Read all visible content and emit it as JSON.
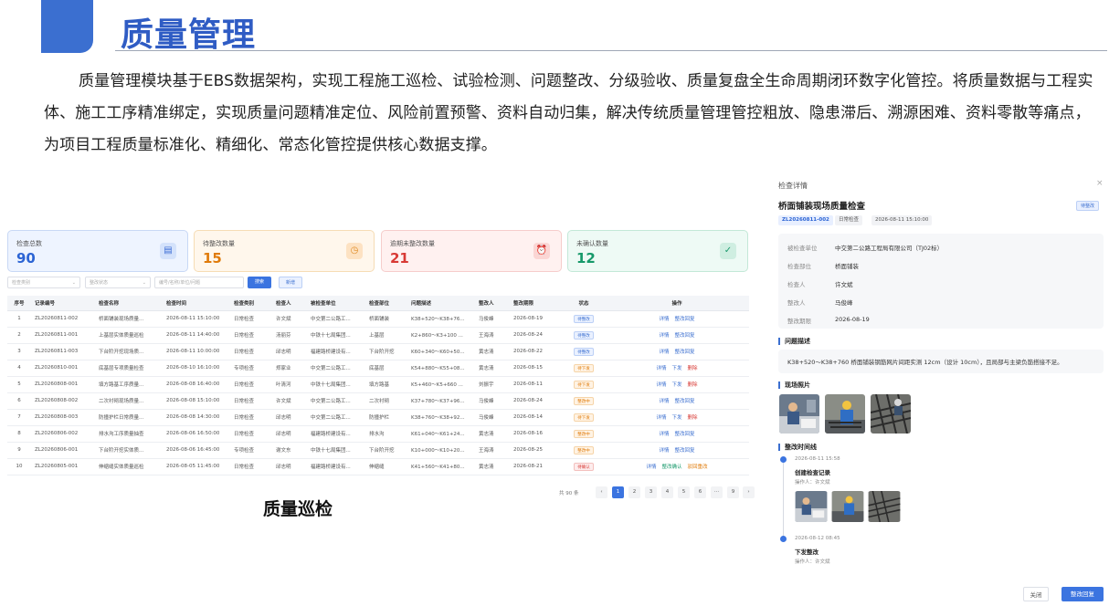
{
  "header": {
    "title": "质量管理",
    "intro": "质量管理模块基于EBS数据架构，实现工程施工巡检、试验检测、问题整改、分级验收、质量复盘全生命周期闭环数字化管控。将质量数据与工程实体、施工工序精准绑定，实现质量问题精准定位、风险前置预警、资料自动归集，解决传统质量管理管控粗放、隐患滞后、溯源困难、资料零散等痛点，为项目工程质量标准化、精细化、常态化管控提供核心数据支撑。"
  },
  "stats": [
    {
      "label": "检查总数",
      "value": "90",
      "icon": "document-icon"
    },
    {
      "label": "待整改数量",
      "value": "15",
      "icon": "clock-icon"
    },
    {
      "label": "逾期未整改数量",
      "value": "21",
      "icon": "alarm-icon"
    },
    {
      "label": "未确认数量",
      "value": "12",
      "icon": "check-circle-icon"
    }
  ],
  "filters": {
    "type_placeholder": "检查类别",
    "status_placeholder": "整改状态",
    "search_placeholder": "编号/名称/单位/问题",
    "search_btn": "搜索",
    "add_btn": "新增"
  },
  "table": {
    "headers": [
      "序号",
      "记录编号",
      "检查名称",
      "检查时间",
      "检查类别",
      "检查人",
      "被检查单位",
      "检查部位",
      "问题描述",
      "整改人",
      "整改期限",
      "状态",
      "操作"
    ],
    "rows": [
      {
        "no": "1",
        "code": "ZL20260811-002",
        "name": "桥面铺装现场质量...",
        "time": "2026-08-11 15:10:00",
        "cat": "日常检查",
        "checker": "许文斌",
        "unit": "中交第二公路工...",
        "part": "桥面铺装",
        "desc": "K38+520～K38+76...",
        "fixer": "马俊峰",
        "due": "2026-08-19",
        "status": "待整改",
        "tag": "blue",
        "ops": [
          [
            "详情",
            "blue"
          ],
          [
            "整改回复",
            "blue"
          ]
        ]
      },
      {
        "no": "2",
        "code": "ZL20260811-001",
        "name": "上基层实体质量巡检",
        "time": "2026-08-11 14:40:00",
        "cat": "日常检查",
        "checker": "汤丽芬",
        "unit": "中铁十七局集团...",
        "part": "上基层",
        "desc": "K2+860～K3+100 ...",
        "fixer": "王海涛",
        "due": "2026-08-24",
        "status": "待整改",
        "tag": "blue",
        "ops": [
          [
            "详情",
            "blue"
          ],
          [
            "整改回复",
            "blue"
          ]
        ]
      },
      {
        "no": "3",
        "code": "ZL20260811-003",
        "name": "下台阶开挖现场质...",
        "time": "2026-08-11 10:00:00",
        "cat": "日常检查",
        "checker": "邱志明",
        "unit": "福建路桥建设有...",
        "part": "下台阶开挖",
        "desc": "K60+340～K60+50...",
        "fixer": "黄志清",
        "due": "2026-08-22",
        "status": "待整改",
        "tag": "blue",
        "ops": [
          [
            "详情",
            "blue"
          ],
          [
            "整改回复",
            "blue"
          ]
        ]
      },
      {
        "no": "4",
        "code": "ZL20260810-001",
        "name": "底基层专项质量检查",
        "time": "2026-08-10 16:10:00",
        "cat": "专项检查",
        "checker": "郑家业",
        "unit": "中交第二公路工...",
        "part": "底基层",
        "desc": "K54+880～K55+08...",
        "fixer": "黄志清",
        "due": "2026-08-15",
        "status": "待下发",
        "tag": "orange",
        "ops": [
          [
            "详情",
            "blue"
          ],
          [
            "下发",
            "blue"
          ],
          [
            "删除",
            "red"
          ]
        ]
      },
      {
        "no": "5",
        "code": "ZL20260808-001",
        "name": "填方路基工序质量...",
        "time": "2026-08-08 16:40:00",
        "cat": "日常检查",
        "checker": "叶清河",
        "unit": "中铁十七局集团...",
        "part": "填方路基",
        "desc": "K5+460～K5+660 ...",
        "fixer": "刘振宇",
        "due": "2026-08-11",
        "status": "待下发",
        "tag": "orange",
        "ops": [
          [
            "详情",
            "blue"
          ],
          [
            "下发",
            "blue"
          ],
          [
            "删除",
            "red"
          ]
        ]
      },
      {
        "no": "6",
        "code": "ZL20260808-002",
        "name": "二次衬砌现场质量...",
        "time": "2026-08-08 15:10:00",
        "cat": "日常检查",
        "checker": "许文斌",
        "unit": "中交第二公路工...",
        "part": "二次衬砌",
        "desc": "K37+780～K37+96...",
        "fixer": "马俊峰",
        "due": "2026-08-24",
        "status": "整改中",
        "tag": "orange",
        "ops": [
          [
            "详情",
            "blue"
          ],
          [
            "整改回复",
            "blue"
          ]
        ]
      },
      {
        "no": "7",
        "code": "ZL20260808-003",
        "name": "防撞护栏日常质量...",
        "time": "2026-08-08 14:30:00",
        "cat": "日常检查",
        "checker": "邱志明",
        "unit": "中交第二公路工...",
        "part": "防撞护栏",
        "desc": "K38+760～K38+92...",
        "fixer": "马俊峰",
        "due": "2026-08-14",
        "status": "待下发",
        "tag": "orange",
        "ops": [
          [
            "详情",
            "blue"
          ],
          [
            "下发",
            "blue"
          ],
          [
            "删除",
            "red"
          ]
        ]
      },
      {
        "no": "8",
        "code": "ZL20260806-002",
        "name": "排水沟工序质量抽查",
        "time": "2026-08-06 16:50:00",
        "cat": "日常检查",
        "checker": "邱志明",
        "unit": "福建路桥建设有...",
        "part": "排水沟",
        "desc": "K61+040～K61+24...",
        "fixer": "黄志清",
        "due": "2026-08-16",
        "status": "整改中",
        "tag": "orange",
        "ops": [
          [
            "详情",
            "blue"
          ],
          [
            "整改回复",
            "blue"
          ]
        ]
      },
      {
        "no": "9",
        "code": "ZL20260806-001",
        "name": "下台阶开挖实体质...",
        "time": "2026-08-06 16:45:00",
        "cat": "专项检查",
        "checker": "谢文东",
        "unit": "中铁十七局集团...",
        "part": "下台阶开挖",
        "desc": "K10+000～K10+20...",
        "fixer": "王海涛",
        "due": "2026-08-25",
        "status": "整改中",
        "tag": "orange",
        "ops": [
          [
            "详情",
            "blue"
          ],
          [
            "整改回复",
            "blue"
          ]
        ]
      },
      {
        "no": "10",
        "code": "ZL20260805-001",
        "name": "伸缩缝实体质量巡检",
        "time": "2026-08-05 11:45:00",
        "cat": "日常检查",
        "checker": "邱志明",
        "unit": "福建路桥建设有...",
        "part": "伸缩缝",
        "desc": "K41+560～K41+80...",
        "fixer": "黄志清",
        "due": "2026-08-21",
        "status": "待确认",
        "tag": "red",
        "ops": [
          [
            "详情",
            "blue"
          ],
          [
            "整改确认",
            "green"
          ],
          [
            "驳回重改",
            "orange"
          ]
        ]
      }
    ]
  },
  "pager": {
    "total": "共 90 条",
    "prev": "‹",
    "pages": [
      "1",
      "2",
      "3",
      "4",
      "5",
      "6",
      "···",
      "9"
    ],
    "next": "›"
  },
  "caption_left": "质量巡检",
  "detail": {
    "head": "检查详情",
    "close": "×",
    "title": "桥面铺装现场质量检查",
    "status": "待整改",
    "chips": [
      "ZL20260811-002",
      "日常检查",
      "2026-08-11 15:10:00"
    ],
    "info": [
      {
        "k": "被检查单位",
        "v": "中交第二公路工程局有限公司（TJ02标）"
      },
      {
        "k": "检查部位",
        "v": "桥面铺装"
      },
      {
        "k": "检查人",
        "v": "许文斌"
      },
      {
        "k": "整改人",
        "v": "马俊峰"
      },
      {
        "k": "整改期限",
        "v": "2026-08-19"
      }
    ],
    "sec_desc": "问题描述",
    "desc": "K38+520～K38+760 桥面铺装钢筋网片间距实测 12cm（设计 10cm），且局部与主梁负筋搭接不足。",
    "sec_photos": "现场照片",
    "sec_timeline": "整改时间线",
    "timeline": [
      {
        "time": "2026-08-11 15:58",
        "title": "创建检查记录",
        "op": "操作人：许文斌"
      },
      {
        "time": "2026-08-12 08:45",
        "title": "下发整改",
        "op": "操作人：许文斌"
      }
    ],
    "btn_close": "关闭",
    "btn_reply": "整改回复"
  }
}
